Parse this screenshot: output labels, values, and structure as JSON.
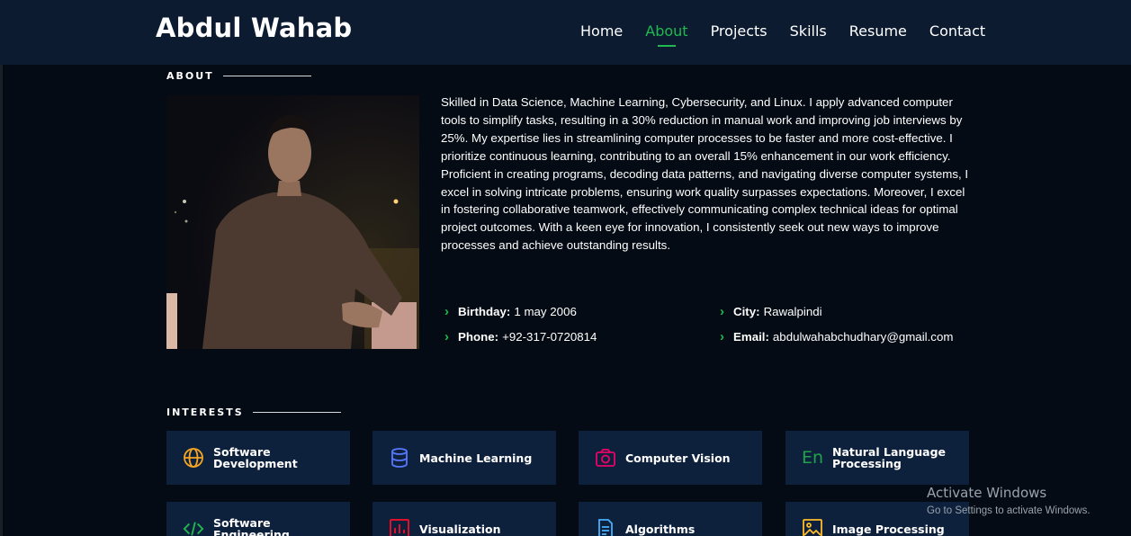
{
  "header": {
    "brand": "Abdul Wahab",
    "nav": [
      {
        "label": "Home"
      },
      {
        "label": "About"
      },
      {
        "label": "Projects"
      },
      {
        "label": "Skills"
      },
      {
        "label": "Resume"
      },
      {
        "label": "Contact"
      }
    ],
    "active_nav": "About"
  },
  "about": {
    "section_title": "ABOUT",
    "paragraph": "Skilled in Data Science, Machine Learning, Cybersecurity, and Linux. I apply advanced computer tools to simplify tasks, resulting in a 30% reduction in manual work and improving job interviews by 25%. My expertise lies in streamlining computer processes to be faster and more cost-effective. I prioritize continuous learning, contributing to an overall 15% enhancement in our work efficiency. Proficient in creating programs, decoding data patterns, and navigating diverse computer systems, I excel in solving intricate problems, ensuring work quality surpasses expectations. Moreover, I excel in fostering collaborative teamwork, effectively communicating complex technical ideas for optimal project outcomes. With a keen eye for innovation, I consistently seek out new ways to improve processes and achieve outstanding results.",
    "info": {
      "birthday_label": "Birthday:",
      "birthday": "1 may 2006",
      "city_label": "City:",
      "city": "Rawalpindi",
      "phone_label": "Phone:",
      "phone": "+92-317-0720814",
      "email_label": "Email:",
      "email": "abdulwahabchudhary@gmail.com"
    }
  },
  "interests": {
    "section_title": "INTERESTS",
    "items": [
      {
        "label_1": "Software",
        "label_2": "Development",
        "icon": "globe-icon",
        "color": "#f5a623"
      },
      {
        "label_1": "Machine Learning",
        "label_2": "",
        "icon": "database-icon",
        "color": "#5578ff"
      },
      {
        "label_1": "Computer Vision",
        "label_2": "",
        "icon": "camera-icon",
        "color": "#e80368"
      },
      {
        "label_1": "Natural Language",
        "label_2": "Processing",
        "icon": "language-icon",
        "color": "#1fa34a",
        "icon_text": "En"
      },
      {
        "label_1": "Software",
        "label_2": "Engineering",
        "icon": "code-icon",
        "color": "#1fb94f"
      },
      {
        "label_1": "Visualization",
        "label_2": "",
        "icon": "bar-chart-icon",
        "color": "#e0102a"
      },
      {
        "label_1": "Algorithms",
        "label_2": "",
        "icon": "document-icon",
        "color": "#47aeff"
      },
      {
        "label_1": "Image Processing",
        "label_2": "",
        "icon": "image-icon",
        "color": "#ffbb2c"
      }
    ]
  },
  "watermark": {
    "line1": "Activate Windows",
    "line2": "Go to Settings to activate Windows."
  },
  "colors": {
    "accent": "#1fb94f",
    "header_bg": "#0c1b30",
    "page_bg": "#040b14",
    "card_bg": "#0e213c"
  }
}
